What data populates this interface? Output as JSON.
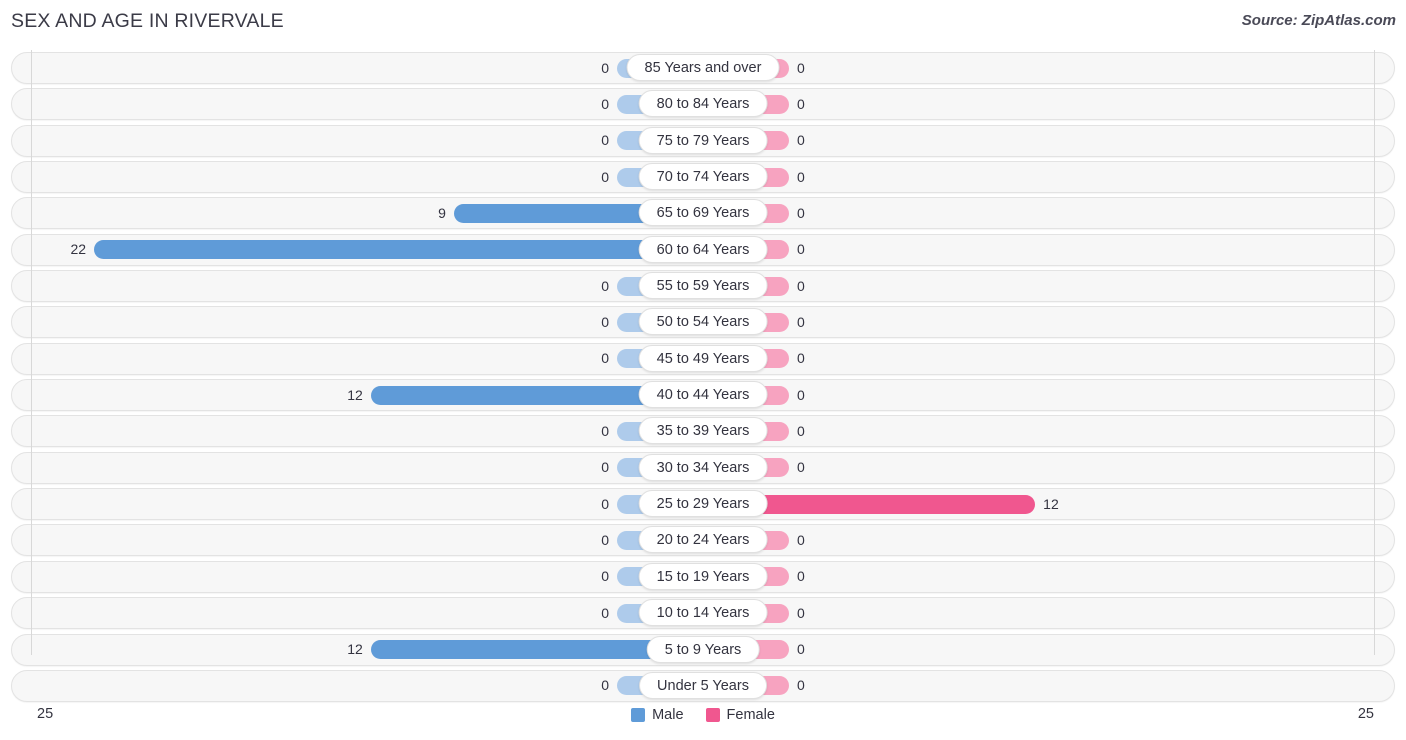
{
  "header": {
    "title": "SEX AND AGE IN RIVERVALE",
    "source": "Source: ZipAtlas.com"
  },
  "axis": {
    "left_tick": "25",
    "right_tick": "25"
  },
  "legend": {
    "male_label": "Male",
    "female_label": "Female",
    "male_color": "#5f9bd8",
    "female_color": "#f0578f"
  },
  "colors": {
    "male_strong": "#5f9bd8",
    "male_light": "#aecbeb",
    "female_strong": "#f0578f",
    "female_light": "#f7a3c0",
    "track_bg": "#f7f7f7",
    "track_border": "#e3e3e3",
    "axis_line": "#d8d8d8",
    "text": "#33333f"
  },
  "chart_data": {
    "type": "bar",
    "title": "SEX AND AGE IN RIVERVALE",
    "subtitle": "Source: ZipAtlas.com",
    "orientation": "horizontal",
    "style": "population-pyramid",
    "xlabel": "",
    "ylabel": "",
    "xlim": [
      0,
      25
    ],
    "axis_max": 25,
    "grid": false,
    "legend_position": "bottom-center",
    "categories": [
      "85 Years and over",
      "80 to 84 Years",
      "75 to 79 Years",
      "70 to 74 Years",
      "65 to 69 Years",
      "60 to 64 Years",
      "55 to 59 Years",
      "50 to 54 Years",
      "45 to 49 Years",
      "40 to 44 Years",
      "35 to 39 Years",
      "30 to 34 Years",
      "25 to 29 Years",
      "20 to 24 Years",
      "15 to 19 Years",
      "10 to 14 Years",
      "5 to 9 Years",
      "Under 5 Years"
    ],
    "series": [
      {
        "name": "Male",
        "color": "#5f9bd8",
        "side": "left",
        "values": [
          0,
          0,
          0,
          0,
          9,
          22,
          0,
          0,
          0,
          12,
          0,
          0,
          0,
          0,
          0,
          0,
          12,
          0
        ]
      },
      {
        "name": "Female",
        "color": "#f0578f",
        "side": "right",
        "values": [
          0,
          0,
          0,
          0,
          0,
          0,
          0,
          0,
          0,
          0,
          0,
          0,
          12,
          0,
          0,
          0,
          0,
          0
        ]
      }
    ]
  }
}
